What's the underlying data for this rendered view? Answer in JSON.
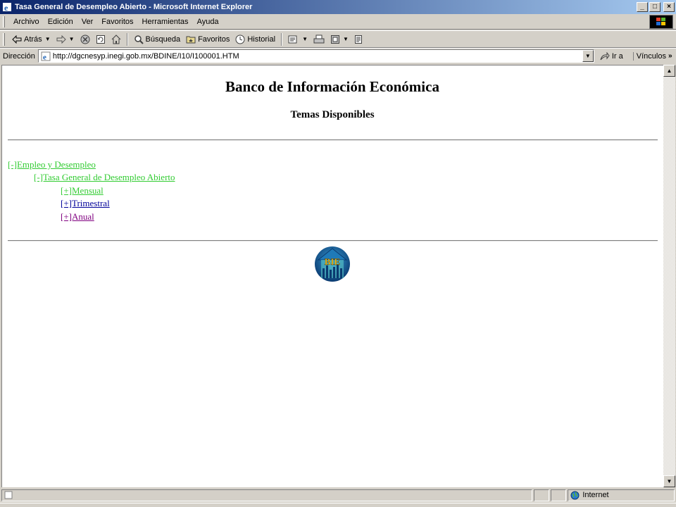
{
  "window": {
    "title": "Tasa General de Desempleo Abierto - Microsoft Internet Explorer",
    "minimize": "_",
    "maximize": "□",
    "close": "×"
  },
  "menu": [
    "Archivo",
    "Edición",
    "Ver",
    "Favoritos",
    "Herramientas",
    "Ayuda"
  ],
  "toolbar": {
    "back": "Atrás",
    "search": "Búsqueda",
    "favorites": "Favoritos",
    "history": "Historial"
  },
  "address": {
    "label": "Dirección",
    "url": "http://dgcnesyp.inegi.gob.mx/BDINE/I10/I100001.HTM",
    "go": "Ir a",
    "links": "Vínculos"
  },
  "page": {
    "title": "Banco de Información Económica",
    "subtitle": "Temas Disponibles",
    "tree": [
      {
        "text": "[-]Empleo y Desempleo",
        "level": 0,
        "state": "green"
      },
      {
        "text": "[-]Tasa General de Desempleo Abierto",
        "level": 1,
        "state": "green"
      },
      {
        "text": "[+]Mensual",
        "level": 2,
        "state": "green"
      },
      {
        "text": "[+]Trimestral",
        "level": 2,
        "state": "blue"
      },
      {
        "text": "[+]Anual",
        "level": 2,
        "state": "purple"
      }
    ],
    "logo_text": "BIE"
  },
  "status": {
    "zone": "Internet"
  },
  "colors": {
    "link_green": "#33cc33",
    "link_blue": "#000099",
    "link_visited": "#800080",
    "titlebar": "#0a246a"
  }
}
